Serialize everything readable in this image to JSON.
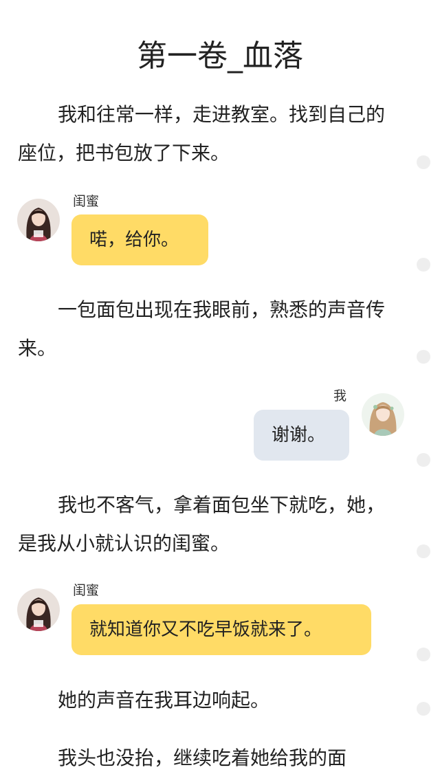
{
  "chapter_title": "第一卷_血落",
  "paragraphs": [
    "我和往常一样，走进教室。找到自己的座位，把书包放了下来。",
    "一包面包出现在我眼前，熟悉的声音传来。",
    "我也不客气，拿着面包坐下就吃，她，是我从小就认识的闺蜜。",
    "她的声音在我耳边响起。",
    "我头也没抬，继续吃着她给我的面"
  ],
  "dialogues": [
    {
      "speaker": "闺蜜",
      "text": "喏，给你。",
      "side": "left"
    },
    {
      "speaker": "我",
      "text": "谢谢。",
      "side": "right"
    },
    {
      "speaker": "闺蜜",
      "text": "就知道你又不吃早饭就来了。",
      "side": "left"
    }
  ],
  "icons": {
    "friend_avatar": "girl-dark-hair-avatar-icon",
    "me_avatar": "girl-light-hair-avatar-icon",
    "scroll_marker": "paragraph-dot-icon"
  },
  "colors": {
    "left_bubble": "#ffdb66",
    "right_bubble": "#e1e7ef",
    "text": "#222222"
  }
}
